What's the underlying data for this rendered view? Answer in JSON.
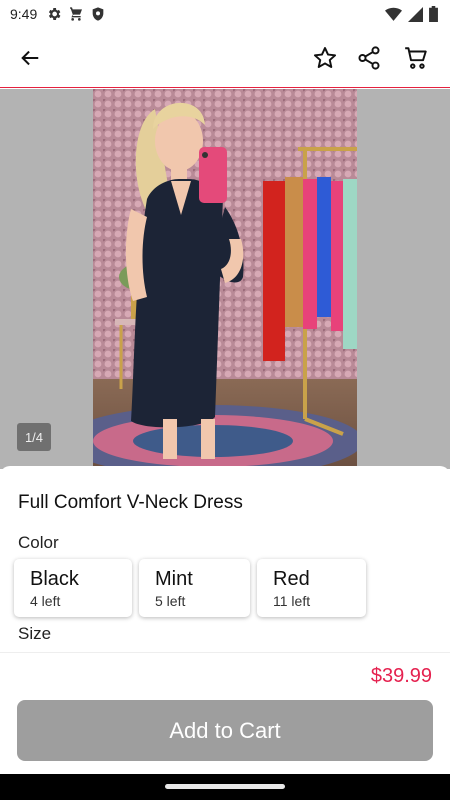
{
  "status_bar": {
    "time": "9:49",
    "left_icons": [
      "gear-icon",
      "cart-icon",
      "shield-icon"
    ],
    "right_icons": [
      "wifi-icon",
      "signal-icon",
      "battery-icon"
    ]
  },
  "app_bar": {
    "icons": [
      "back-arrow-icon",
      "star-icon",
      "share-icon",
      "cart-icon"
    ]
  },
  "gallery": {
    "counter": "1/4"
  },
  "product": {
    "title": "Full Comfort V-Neck Dress",
    "color_label": "Color",
    "size_label": "Size",
    "colors": [
      {
        "name": "Black",
        "stock": "4 left"
      },
      {
        "name": "Mint",
        "stock": "5 left"
      },
      {
        "name": "Red",
        "stock": "11 left"
      }
    ],
    "price": "$39.99"
  },
  "actions": {
    "add_to_cart": "Add to Cart"
  },
  "colors": {
    "accent": "#e5214f",
    "button_disabled": "#9e9e9e"
  }
}
